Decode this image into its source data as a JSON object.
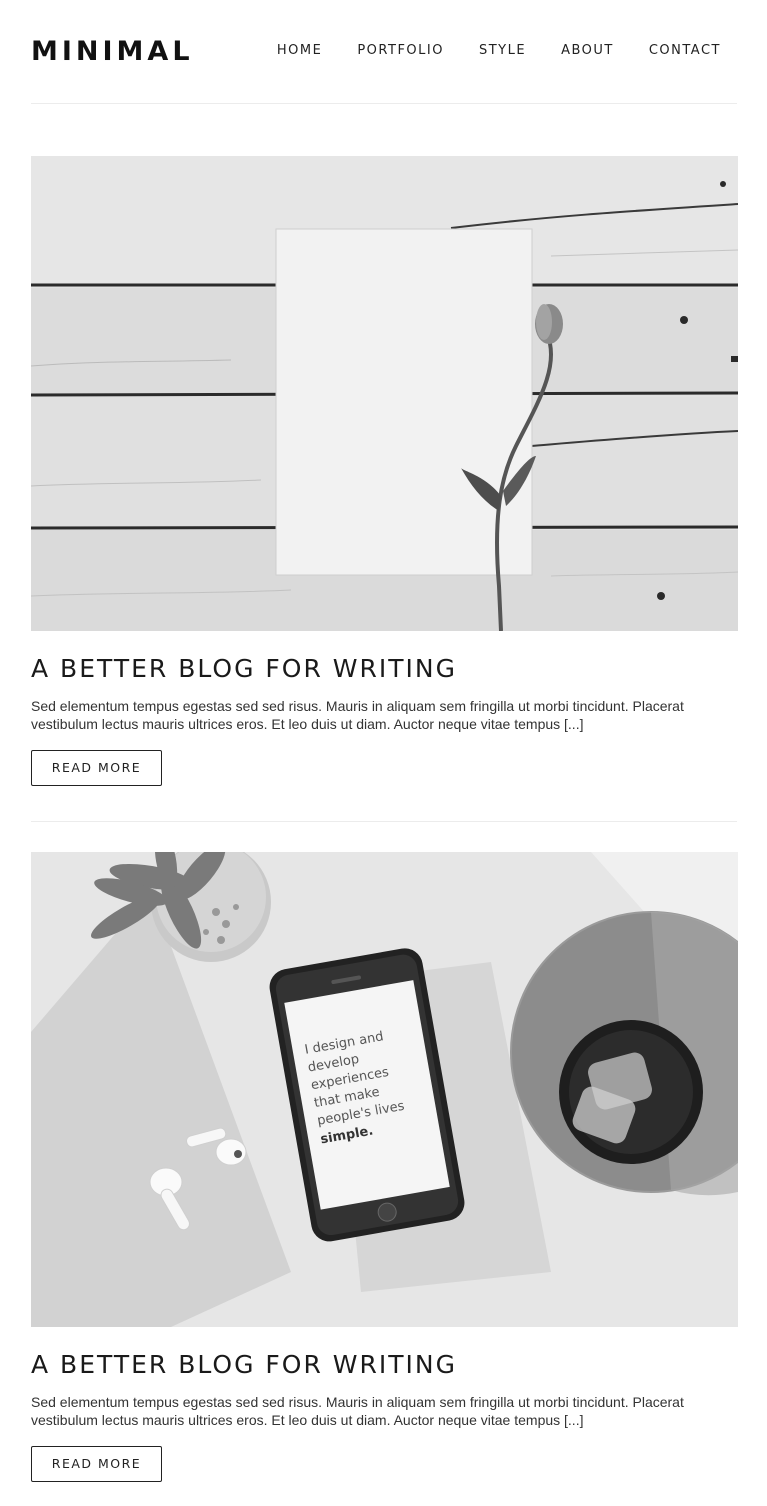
{
  "site": {
    "logo": "MINIMAL",
    "nav": [
      "HOME",
      "PORTFOLIO",
      "STYLE",
      "ABOUT",
      "CONTACT"
    ]
  },
  "posts": [
    {
      "title": "A BETTER BLOG FOR WRITING",
      "excerpt": "Sed elementum tempus egestas sed sed risus. Mauris in aliquam sem fringilla ut morbi tincidunt. Placerat vestibulum lectus mauris ultrices eros. Et leo duis ut diam. Auctor neque vitae tempus [...]",
      "button": "READ MORE",
      "image": "wooden-planks-paper-tulip"
    },
    {
      "title": "A BETTER BLOG FOR WRITING",
      "excerpt": "Sed elementum tempus egestas sed sed risus. Mauris in aliquam sem fringilla ut morbi tincidunt. Placerat vestibulum lectus mauris ultrices eros. Et leo duis ut diam. Auctor neque vitae tempus [...]",
      "button": "READ MORE",
      "image": "desk-phone-succulent-coffee",
      "phone_text": [
        "I design and",
        "develop",
        "experiences",
        "that make",
        "people's lives"
      ],
      "phone_text_bold": "simple."
    }
  ]
}
